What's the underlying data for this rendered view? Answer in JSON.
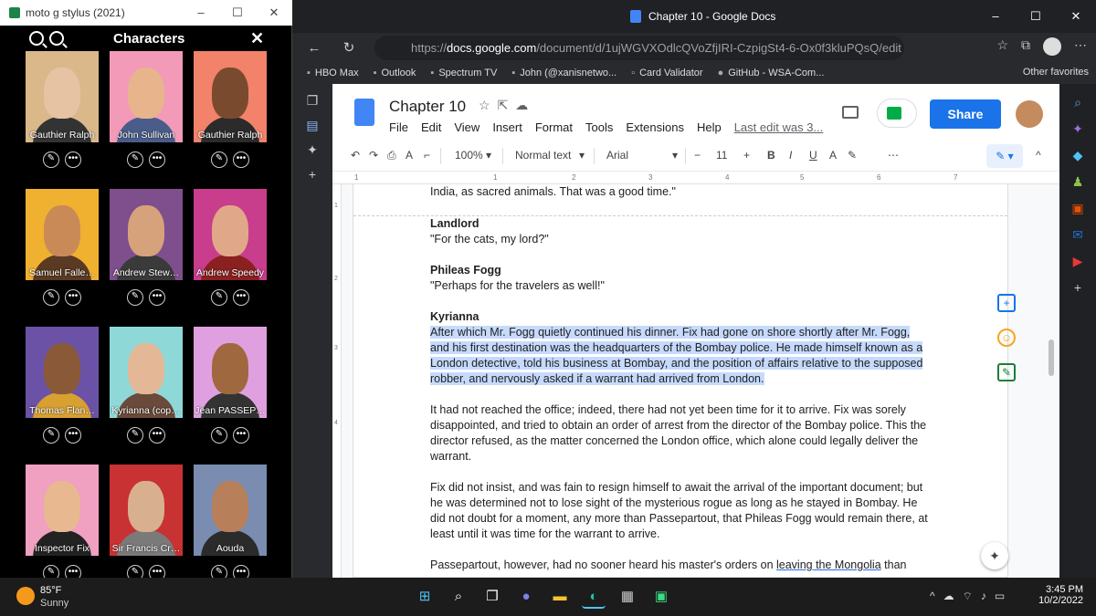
{
  "phone": {
    "window_title": "moto g stylus (2021)",
    "window_controls": [
      "–",
      "☐",
      "✕"
    ],
    "header_title": "Characters",
    "close_glyph": "✕",
    "characters": [
      {
        "name": "Gauthier Ralph",
        "bg": "#dbb88a",
        "skin": "#e6c3a3",
        "shirt": "#333333"
      },
      {
        "name": "John Sullivan",
        "bg": "#f29ab8",
        "skin": "#e8b48c",
        "shirt": "#4a5d8a"
      },
      {
        "name": "Gauthier Ralph",
        "bg": "#f2826a",
        "skin": "#7a4a2e",
        "shirt": "#2b2b2b"
      },
      {
        "name": "Samuel Falle…",
        "bg": "#f0b030",
        "skin": "#c98a58",
        "shirt": "#5a3a22"
      },
      {
        "name": "Andrew Stew…",
        "bg": "#7e4f8c",
        "skin": "#d6a27c",
        "shirt": "#3a3a3a"
      },
      {
        "name": "Andrew Speedy",
        "bg": "#c83d8c",
        "skin": "#e0a888",
        "shirt": "#8b2020"
      },
      {
        "name": "Thomas Flan…",
        "bg": "#6b52a6",
        "skin": "#8a5a38",
        "shirt": "#d8a030"
      },
      {
        "name": "Kyrianna (cop…",
        "bg": "#8fd8d8",
        "skin": "#e4b896",
        "shirt": "#6a4a3a"
      },
      {
        "name": "Jean PASSEP…",
        "bg": "#e0a0e0",
        "skin": "#a0683e",
        "shirt": "#333333"
      },
      {
        "name": "Inspector Fix",
        "bg": "#f0a0c0",
        "skin": "#e8b890",
        "shirt": "#222222"
      },
      {
        "name": "Sir Francis Cr…",
        "bg": "#c83232",
        "skin": "#d8b090",
        "shirt": "#7a7a7a"
      },
      {
        "name": "Aouda",
        "bg": "#7a8cb0",
        "skin": "#b8805a",
        "shirt": "#2b2b2b"
      }
    ],
    "edit_glyph": "✎",
    "more_glyph": "•••"
  },
  "browser": {
    "window_title": "Chapter 10 - Google Docs",
    "window_controls": [
      "–",
      "☐",
      "✕"
    ],
    "url_prefix": "https://",
    "url_host": "docs.google.com",
    "url_rest": "/document/d/1ujWGVXOdlcQVoZfjIRI-CzpigSt4-6-Ox0f3kluPQsQ/edit",
    "favorites": [
      {
        "icon": "▪",
        "label": "HBO Max"
      },
      {
        "icon": "▪",
        "label": "Outlook"
      },
      {
        "icon": "▪",
        "label": "Spectrum TV"
      },
      {
        "icon": "▪",
        "label": "John (@xanisnetwo..."
      },
      {
        "icon": "▫",
        "label": "Card Validator"
      },
      {
        "icon": "●",
        "label": "GitHub - WSA-Com..."
      }
    ],
    "other_favorites": "Other favorites"
  },
  "docs": {
    "title": "Chapter 10",
    "menus": [
      "File",
      "Edit",
      "View",
      "Insert",
      "Format",
      "Tools",
      "Extensions",
      "Help"
    ],
    "last_edit": "Last edit was 3...",
    "share_label": "Share",
    "zoom": "100%",
    "style": "Normal text",
    "font": "Arial",
    "font_size": "11",
    "ruler_numbers": [
      "1",
      "1",
      "2",
      "3",
      "4",
      "5",
      "6",
      "7"
    ],
    "vruler_numbers": [
      "1",
      "2",
      "3",
      "4"
    ],
    "paragraphs": [
      {
        "type": "text",
        "text": "India, as sacred animals. That was a good time.\""
      },
      {
        "type": "speaker",
        "speaker": "Landlord",
        "text": "\"For the cats, my lord?\""
      },
      {
        "type": "speaker",
        "speaker": "Phileas Fogg",
        "text": "\"Perhaps for the travelers as well!\""
      },
      {
        "type": "speaker_hl",
        "speaker": "Kyrianna",
        "text": "After which Mr. Fogg quietly continued his dinner. Fix had gone on shore shortly after Mr. Fogg, and his first destination was the headquarters of the Bombay police. He made himself known as a London detective, told his business at Bombay, and the position of affairs relative to the supposed robber, and nervously asked if a warrant had arrived from London."
      },
      {
        "type": "text",
        "text": "It had not reached the office; indeed, there had not yet been time for it to arrive. Fix was sorely disappointed, and tried to obtain an order of arrest from the director of the Bombay police. This the director refused, as the matter concerned the London office, which alone could legally deliver the warrant."
      },
      {
        "type": "text",
        "text": "Fix did not insist, and was fain to resign himself to await the arrival of the important document; but he was determined not to lose sight of the mysterious rogue as long as he stayed in Bombay. He did not doubt for a moment, any more than Passepartout, that Phileas Fogg would remain there, at least until it was time for the warrant to arrive."
      },
      {
        "type": "partial",
        "before": "Passepartout, however, had no sooner heard his master's orders on ",
        "link": "leaving the Mongolia",
        "after": " than"
      }
    ]
  },
  "taskbar": {
    "temp": "85°F",
    "weather": "Sunny",
    "time": "3:45 PM",
    "date": "10/2/2022"
  }
}
